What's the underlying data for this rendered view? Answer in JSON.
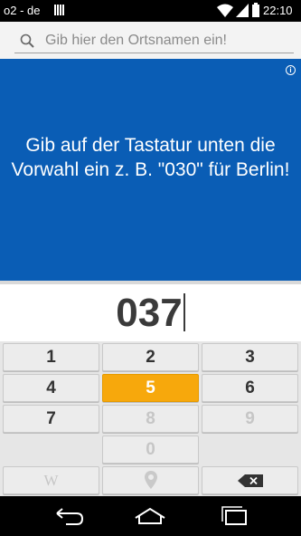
{
  "status_bar": {
    "carrier": "o2 - de",
    "time": "22:10",
    "icons": [
      "sim-card-icon",
      "wifi-icon",
      "signal-icon",
      "battery-icon"
    ]
  },
  "search": {
    "placeholder": "Gib hier den Ortsnamen ein!",
    "value": ""
  },
  "banner": {
    "text": "Gib auf der Tastatur unten die Vorwahl ein z. B. \"030\" für Berlin!",
    "info_symbol": "i",
    "background_color": "#0a5db5"
  },
  "display": {
    "value": "037"
  },
  "keypad": {
    "keys": [
      {
        "label": "1",
        "state": "normal"
      },
      {
        "label": "2",
        "state": "normal"
      },
      {
        "label": "3",
        "state": "normal"
      },
      {
        "label": "4",
        "state": "normal"
      },
      {
        "label": "5",
        "state": "highlighted"
      },
      {
        "label": "6",
        "state": "normal"
      },
      {
        "label": "7",
        "state": "normal"
      },
      {
        "label": "8",
        "state": "disabled"
      },
      {
        "label": "9",
        "state": "disabled"
      },
      {
        "label": "0",
        "state": "disabled"
      }
    ],
    "bottom_row_icons": [
      "wikipedia-icon",
      "location-pin-icon",
      "backspace-icon"
    ],
    "wikipedia_glyph": "W",
    "highlight_color": "#f7a80c"
  },
  "nav_bar": {
    "icons": [
      "back-icon",
      "home-icon",
      "recent-apps-icon"
    ]
  }
}
